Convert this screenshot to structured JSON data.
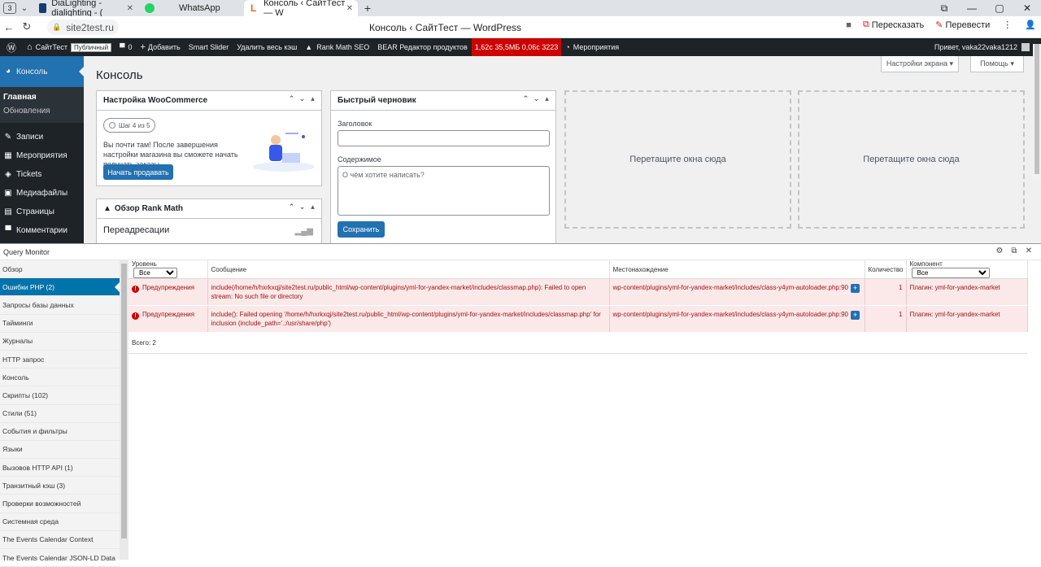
{
  "browser": {
    "tab_count": "3",
    "tabs": [
      {
        "title": "DiaLighting - dialighting - ("
      },
      {
        "title": "WhatsApp"
      },
      {
        "title": "Консоль ‹ СайтТест — W"
      }
    ],
    "url": "site2test.ru",
    "page_title": "Консоль ‹ СайтТест — WordPress",
    "actions": {
      "reshare": "Пересказать",
      "translate": "Перевести"
    }
  },
  "adminbar": {
    "site": "СайтТест",
    "public_badge": "Публичный",
    "comments_count": "0",
    "add": "Добавить",
    "smart_slider": "Smart Slider",
    "clear_cache": "Удалить весь кэш",
    "rank_math": "Rank Math SEO",
    "bear": "BEAR Редактор продуктов",
    "perf": "1,62с  35,5МБ  0,06с  3223",
    "events": "Мероприятия",
    "greeting": "Привет, vaka22vaka1212"
  },
  "wpmenu": {
    "dashboard": "Консоль",
    "sub_home": "Главная",
    "sub_updates": "Обновления",
    "items": [
      "Записи",
      "Мероприятия",
      "Tickets",
      "Медиафайлы",
      "Страницы",
      "Комментарии"
    ]
  },
  "content": {
    "screen_options": "Настройки экрана ▾",
    "help": "Помощь ▾",
    "title": "Консоль",
    "woo": {
      "title": "Настройка WooCommerce",
      "step": "Шаг 4 из 5",
      "text": "Вы почти там! После завершения настройки магазина вы сможете начать получать заказы.",
      "button": "Начать продавать"
    },
    "rankmath": {
      "title": "Обзор Rank Math",
      "subtitle": "Переадресации"
    },
    "draft": {
      "title": "Быстрый черновик",
      "title_label": "Заголовок",
      "content_label": "Содержимое",
      "content_placeholder": "О чём хотите написать?",
      "save": "Сохранить"
    },
    "dropzone": "Перетащите окна сюда"
  },
  "qm": {
    "title": "Query Monitor",
    "nav": [
      "Обзор",
      "Ошибки PHP (2)",
      "Запросы базы данных",
      "Тайминги",
      "Журналы",
      "HTTP запрос",
      "Консоль",
      "Скрипты (102)",
      "Стили (51)",
      "События и фильтры",
      "Языки",
      "Вызовов HTTP API (1)",
      "Транзитный кэш (3)",
      "Проверки возможностей",
      "Системная среда",
      "The Events Calendar Context",
      "The Events Calendar JSON-LD Data"
    ],
    "selected_nav": 1,
    "columns": {
      "level": "Уровень",
      "level_filter": "Все",
      "message": "Сообщение",
      "location": "Местонахождение",
      "count": "Количество",
      "component": "Компонент",
      "component_filter": "Все"
    },
    "rows": [
      {
        "level": "Предупреждения",
        "message": "include(/home/h/hxrkxqj/site2test.ru/public_html/wp-content/plugins/yml-for-yandex-market/includes/classmap.php): Failed to open stream: No such file or directory",
        "location": "wp-content/plugins/yml-for-yandex-market/includes/class-y4ym-autoloader.php:90",
        "count": "1",
        "component": "Плагин: yml-for-yandex-market"
      },
      {
        "level": "Предупреждения",
        "message": "include(): Failed opening '/home/h/hxrkxqj/site2test.ru/public_html/wp-content/plugins/yml-for-yandex-market/includes/classmap.php' for inclusion (include_path='.:/usr/share/php')",
        "location": "wp-content/plugins/yml-for-yandex-market/includes/class-y4ym-autoloader.php:90",
        "count": "1",
        "component": "Плагин: yml-for-yandex-market"
      }
    ],
    "total": "Всего: 2"
  }
}
